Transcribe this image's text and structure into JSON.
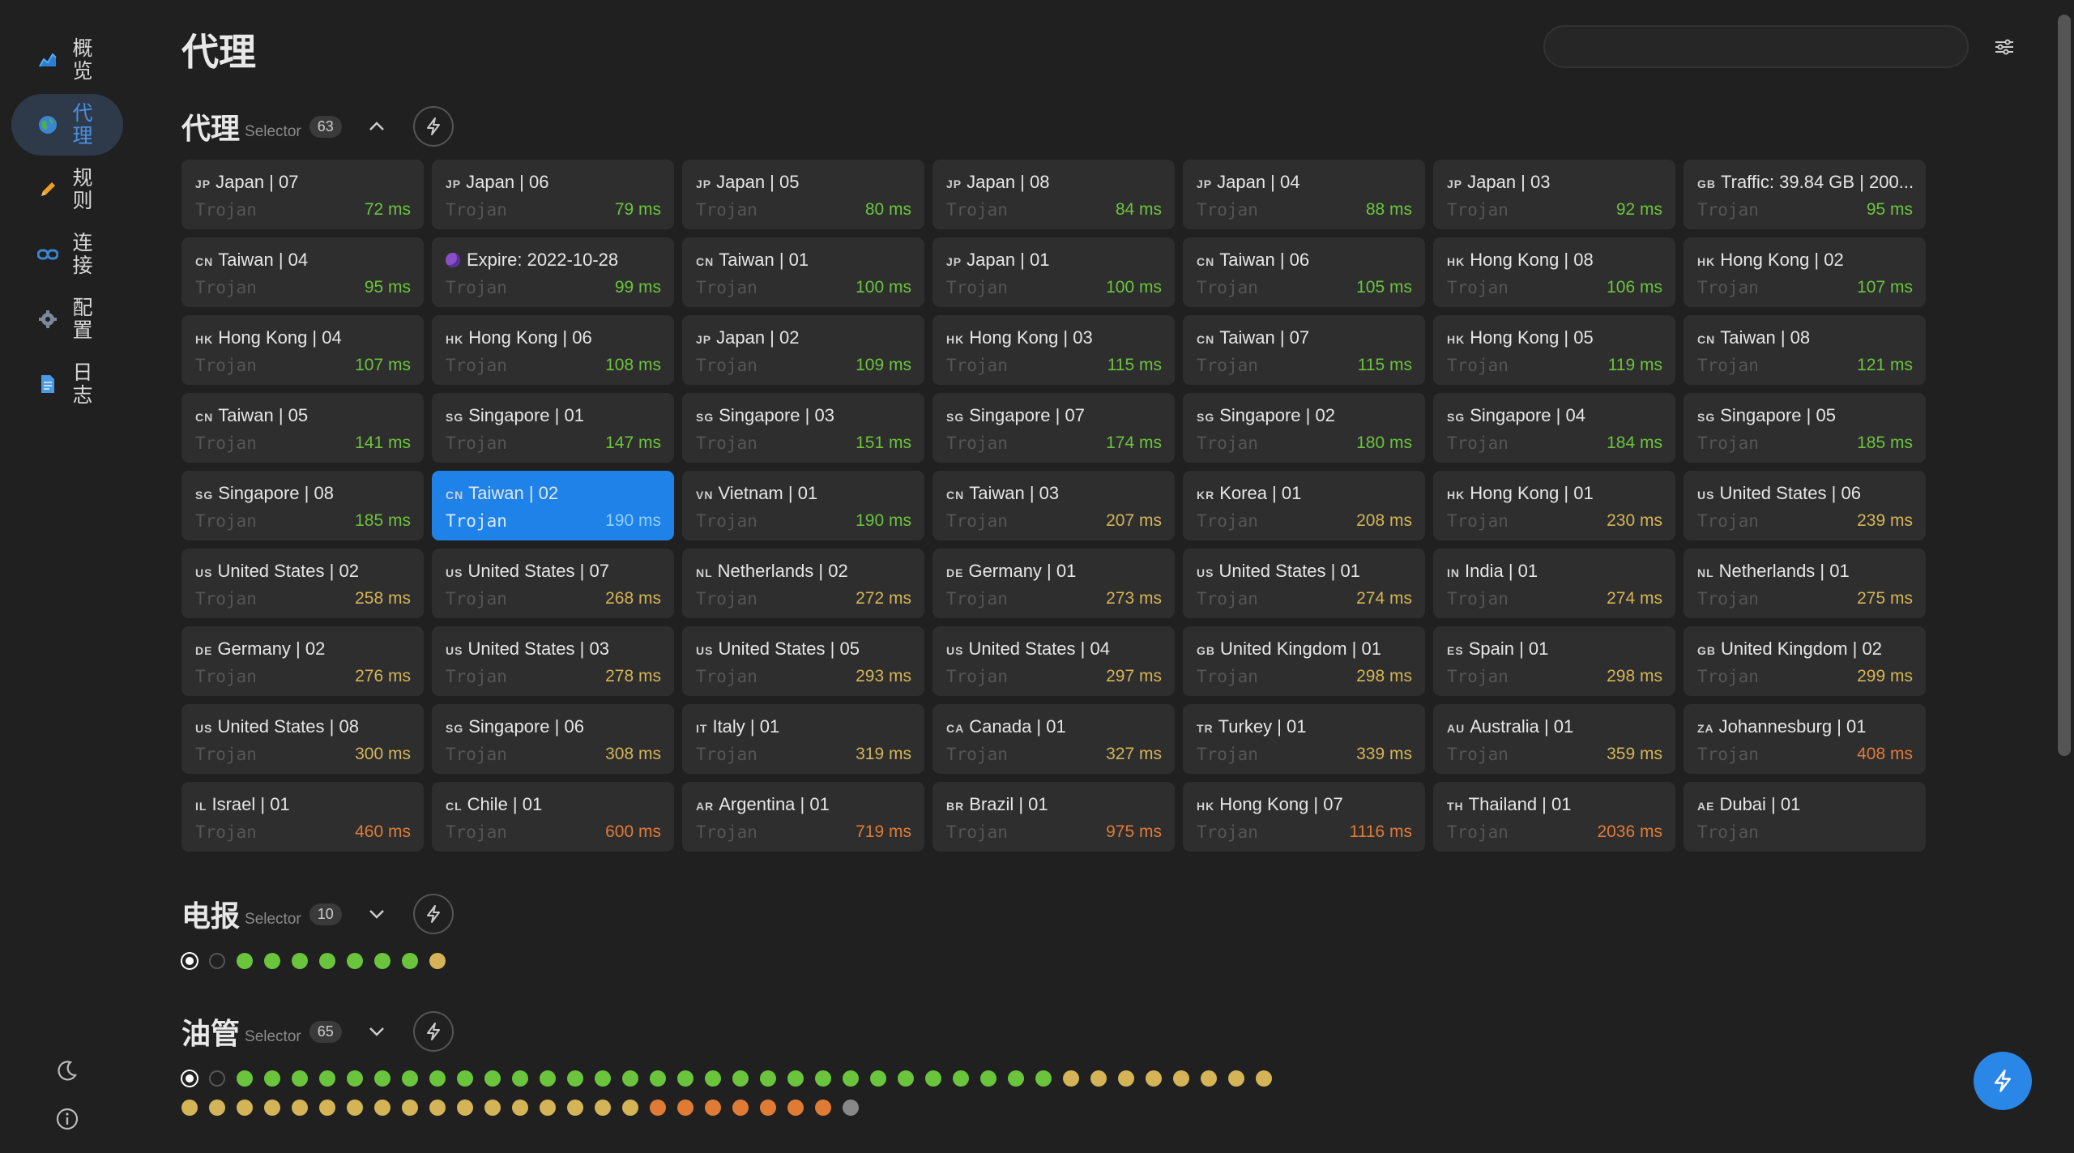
{
  "sidebar": {
    "items": [
      {
        "label": "概览",
        "icon": "chart-icon",
        "active": false
      },
      {
        "label": "代理",
        "icon": "globe-icon",
        "active": true
      },
      {
        "label": "规则",
        "icon": "pencil-icon",
        "active": false
      },
      {
        "label": "连接",
        "icon": "link-icon",
        "active": false
      },
      {
        "label": "配置",
        "icon": "gear-icon",
        "active": false
      },
      {
        "label": "日志",
        "icon": "document-icon",
        "active": false
      }
    ],
    "bottom": [
      "moon-icon",
      "info-icon"
    ]
  },
  "header": {
    "title": "代理",
    "search_value": ""
  },
  "groups": [
    {
      "name": "代理",
      "type": "Selector",
      "count": "63",
      "expanded": true
    },
    {
      "name": "电报",
      "type": "Selector",
      "count": "10",
      "expanded": false
    },
    {
      "name": "油管",
      "type": "Selector",
      "count": "65",
      "expanded": false
    }
  ],
  "colors": {
    "green": "#6ac43c",
    "yellow": "#d4b456",
    "orange": "#e07b36",
    "gray": "#888888",
    "accent": "#1e82e8"
  },
  "proxies": [
    {
      "cc": "JP",
      "name": "Japan | 07",
      "type": "Trojan",
      "delay": "72 ms",
      "level": "green"
    },
    {
      "cc": "JP",
      "name": "Japan | 06",
      "type": "Trojan",
      "delay": "79 ms",
      "level": "green"
    },
    {
      "cc": "JP",
      "name": "Japan | 05",
      "type": "Trojan",
      "delay": "80 ms",
      "level": "green"
    },
    {
      "cc": "JP",
      "name": "Japan | 08",
      "type": "Trojan",
      "delay": "84 ms",
      "level": "green"
    },
    {
      "cc": "JP",
      "name": "Japan | 04",
      "type": "Trojan",
      "delay": "88 ms",
      "level": "green"
    },
    {
      "cc": "JP",
      "name": "Japan | 03",
      "type": "Trojan",
      "delay": "92 ms",
      "level": "green"
    },
    {
      "cc": "GB",
      "name": "Traffic: 39.84 GB | 200...",
      "type": "Trojan",
      "delay": "95 ms",
      "level": "green"
    },
    {
      "cc": "CN",
      "name": "Taiwan | 04",
      "type": "Trojan",
      "delay": "95 ms",
      "level": "green"
    },
    {
      "cc": "",
      "name": "Expire: 2022-10-28",
      "type": "Trojan",
      "delay": "99 ms",
      "level": "green",
      "emoji": true
    },
    {
      "cc": "CN",
      "name": "Taiwan | 01",
      "type": "Trojan",
      "delay": "100 ms",
      "level": "green"
    },
    {
      "cc": "JP",
      "name": "Japan | 01",
      "type": "Trojan",
      "delay": "100 ms",
      "level": "green"
    },
    {
      "cc": "CN",
      "name": "Taiwan | 06",
      "type": "Trojan",
      "delay": "105 ms",
      "level": "green"
    },
    {
      "cc": "HK",
      "name": "Hong Kong | 08",
      "type": "Trojan",
      "delay": "106 ms",
      "level": "green"
    },
    {
      "cc": "HK",
      "name": "Hong Kong | 02",
      "type": "Trojan",
      "delay": "107 ms",
      "level": "green"
    },
    {
      "cc": "HK",
      "name": "Hong Kong | 04",
      "type": "Trojan",
      "delay": "107 ms",
      "level": "green"
    },
    {
      "cc": "HK",
      "name": "Hong Kong | 06",
      "type": "Trojan",
      "delay": "108 ms",
      "level": "green"
    },
    {
      "cc": "JP",
      "name": "Japan | 02",
      "type": "Trojan",
      "delay": "109 ms",
      "level": "green"
    },
    {
      "cc": "HK",
      "name": "Hong Kong | 03",
      "type": "Trojan",
      "delay": "115 ms",
      "level": "green"
    },
    {
      "cc": "CN",
      "name": "Taiwan | 07",
      "type": "Trojan",
      "delay": "115 ms",
      "level": "green"
    },
    {
      "cc": "HK",
      "name": "Hong Kong | 05",
      "type": "Trojan",
      "delay": "119 ms",
      "level": "green"
    },
    {
      "cc": "CN",
      "name": "Taiwan | 08",
      "type": "Trojan",
      "delay": "121 ms",
      "level": "green"
    },
    {
      "cc": "CN",
      "name": "Taiwan | 05",
      "type": "Trojan",
      "delay": "141 ms",
      "level": "green"
    },
    {
      "cc": "SG",
      "name": "Singapore | 01",
      "type": "Trojan",
      "delay": "147 ms",
      "level": "green"
    },
    {
      "cc": "SG",
      "name": "Singapore | 03",
      "type": "Trojan",
      "delay": "151 ms",
      "level": "green"
    },
    {
      "cc": "SG",
      "name": "Singapore | 07",
      "type": "Trojan",
      "delay": "174 ms",
      "level": "green"
    },
    {
      "cc": "SG",
      "name": "Singapore | 02",
      "type": "Trojan",
      "delay": "180 ms",
      "level": "green"
    },
    {
      "cc": "SG",
      "name": "Singapore | 04",
      "type": "Trojan",
      "delay": "184 ms",
      "level": "green"
    },
    {
      "cc": "SG",
      "name": "Singapore | 05",
      "type": "Trojan",
      "delay": "185 ms",
      "level": "green"
    },
    {
      "cc": "SG",
      "name": "Singapore | 08",
      "type": "Trojan",
      "delay": "185 ms",
      "level": "green"
    },
    {
      "cc": "CN",
      "name": "Taiwan | 02",
      "type": "Trojan",
      "delay": "190 ms",
      "level": "green",
      "selected": true
    },
    {
      "cc": "VN",
      "name": "Vietnam | 01",
      "type": "Trojan",
      "delay": "190 ms",
      "level": "green"
    },
    {
      "cc": "CN",
      "name": "Taiwan | 03",
      "type": "Trojan",
      "delay": "207 ms",
      "level": "yellow"
    },
    {
      "cc": "KR",
      "name": "Korea | 01",
      "type": "Trojan",
      "delay": "208 ms",
      "level": "yellow"
    },
    {
      "cc": "HK",
      "name": "Hong Kong | 01",
      "type": "Trojan",
      "delay": "230 ms",
      "level": "yellow"
    },
    {
      "cc": "US",
      "name": "United States | 06",
      "type": "Trojan",
      "delay": "239 ms",
      "level": "yellow"
    },
    {
      "cc": "US",
      "name": "United States | 02",
      "type": "Trojan",
      "delay": "258 ms",
      "level": "yellow"
    },
    {
      "cc": "US",
      "name": "United States | 07",
      "type": "Trojan",
      "delay": "268 ms",
      "level": "yellow"
    },
    {
      "cc": "NL",
      "name": "Netherlands | 02",
      "type": "Trojan",
      "delay": "272 ms",
      "level": "yellow"
    },
    {
      "cc": "DE",
      "name": "Germany | 01",
      "type": "Trojan",
      "delay": "273 ms",
      "level": "yellow"
    },
    {
      "cc": "US",
      "name": "United States | 01",
      "type": "Trojan",
      "delay": "274 ms",
      "level": "yellow"
    },
    {
      "cc": "IN",
      "name": "India | 01",
      "type": "Trojan",
      "delay": "274 ms",
      "level": "yellow"
    },
    {
      "cc": "NL",
      "name": "Netherlands | 01",
      "type": "Trojan",
      "delay": "275 ms",
      "level": "yellow"
    },
    {
      "cc": "DE",
      "name": "Germany | 02",
      "type": "Trojan",
      "delay": "276 ms",
      "level": "yellow"
    },
    {
      "cc": "US",
      "name": "United States | 03",
      "type": "Trojan",
      "delay": "278 ms",
      "level": "yellow"
    },
    {
      "cc": "US",
      "name": "United States | 05",
      "type": "Trojan",
      "delay": "293 ms",
      "level": "yellow"
    },
    {
      "cc": "US",
      "name": "United States | 04",
      "type": "Trojan",
      "delay": "297 ms",
      "level": "yellow"
    },
    {
      "cc": "GB",
      "name": "United Kingdom | 01",
      "type": "Trojan",
      "delay": "298 ms",
      "level": "yellow"
    },
    {
      "cc": "ES",
      "name": "Spain | 01",
      "type": "Trojan",
      "delay": "298 ms",
      "level": "yellow"
    },
    {
      "cc": "GB",
      "name": "United Kingdom | 02",
      "type": "Trojan",
      "delay": "299 ms",
      "level": "yellow"
    },
    {
      "cc": "US",
      "name": "United States | 08",
      "type": "Trojan",
      "delay": "300 ms",
      "level": "yellow"
    },
    {
      "cc": "SG",
      "name": "Singapore | 06",
      "type": "Trojan",
      "delay": "308 ms",
      "level": "yellow"
    },
    {
      "cc": "IT",
      "name": "Italy | 01",
      "type": "Trojan",
      "delay": "319 ms",
      "level": "yellow"
    },
    {
      "cc": "CA",
      "name": "Canada | 01",
      "type": "Trojan",
      "delay": "327 ms",
      "level": "yellow"
    },
    {
      "cc": "TR",
      "name": "Turkey | 01",
      "type": "Trojan",
      "delay": "339 ms",
      "level": "yellow"
    },
    {
      "cc": "AU",
      "name": "Australia | 01",
      "type": "Trojan",
      "delay": "359 ms",
      "level": "yellow"
    },
    {
      "cc": "ZA",
      "name": "Johannesburg | 01",
      "type": "Trojan",
      "delay": "408 ms",
      "level": "orange"
    },
    {
      "cc": "IL",
      "name": "Israel | 01",
      "type": "Trojan",
      "delay": "460 ms",
      "level": "orange"
    },
    {
      "cc": "CL",
      "name": "Chile | 01",
      "type": "Trojan",
      "delay": "600 ms",
      "level": "orange"
    },
    {
      "cc": "AR",
      "name": "Argentina | 01",
      "type": "Trojan",
      "delay": "719 ms",
      "level": "orange"
    },
    {
      "cc": "BR",
      "name": "Brazil | 01",
      "type": "Trojan",
      "delay": "975 ms",
      "level": "orange"
    },
    {
      "cc": "HK",
      "name": "Hong Kong | 07",
      "type": "Trojan",
      "delay": "1116 ms",
      "level": "orange"
    },
    {
      "cc": "TH",
      "name": "Thailand | 01",
      "type": "Trojan",
      "delay": "2036 ms",
      "level": "orange"
    },
    {
      "cc": "AE",
      "name": "Dubai | 01",
      "type": "Trojan",
      "delay": "",
      "level": "gray"
    }
  ],
  "telegram_dots": [
    "selected",
    "empty",
    "green",
    "green",
    "green",
    "green",
    "green",
    "green",
    "green",
    "yellow"
  ],
  "youtube_dots": [
    "selected",
    "empty",
    "green",
    "green",
    "green",
    "green",
    "green",
    "green",
    "green",
    "green",
    "green",
    "green",
    "green",
    "green",
    "green",
    "green",
    "green",
    "green",
    "green",
    "green",
    "green",
    "green",
    "green",
    "green",
    "green",
    "green",
    "green",
    "green",
    "green",
    "green",
    "green",
    "green",
    "yellow",
    "yellow",
    "yellow",
    "yellow",
    "yellow",
    "yellow",
    "yellow",
    "yellow",
    "yellow",
    "yellow",
    "yellow",
    "yellow",
    "yellow",
    "yellow",
    "yellow",
    "yellow",
    "yellow",
    "yellow",
    "yellow",
    "yellow",
    "yellow",
    "yellow",
    "yellow",
    "yellow",
    "yellow",
    "orange",
    "orange",
    "orange",
    "orange",
    "orange",
    "orange",
    "orange",
    "gray"
  ]
}
